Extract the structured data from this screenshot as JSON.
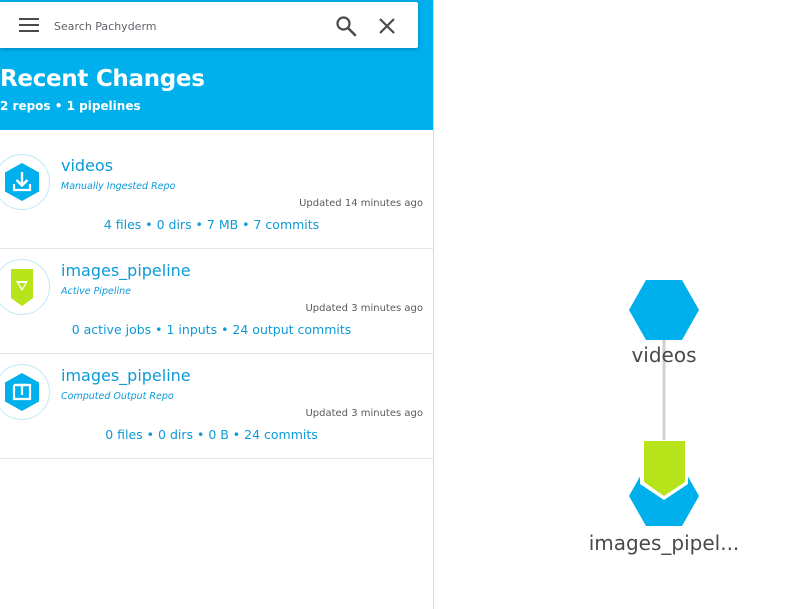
{
  "search": {
    "placeholder": "Search Pachyderm"
  },
  "icons": {
    "menu": "menu-icon",
    "search": "search-icon",
    "close": "close-icon",
    "repo_ingest": "download-hexagon-icon",
    "pipeline": "pipeline-chevron-icon",
    "repo_output": "output-hexagon-icon"
  },
  "header": {
    "title": "Recent Changes",
    "subtitle": "2 repos • 1 pipelines"
  },
  "items": [
    {
      "name": "videos",
      "type": "Manually Ingested Repo",
      "updated": "Updated 14 minutes ago",
      "stats": "4 files • 0 dirs • 7 MB • 7 commits"
    },
    {
      "name": "images_pipeline",
      "type": "Active Pipeline",
      "updated": "Updated 3 minutes ago",
      "stats": "0 active jobs • 1 inputs • 24 output commits"
    },
    {
      "name": "images_pipeline",
      "type": "Computed Output Repo",
      "updated": "Updated 3 minutes ago",
      "stats": "0 files • 0 dirs • 0 B • 24 commits"
    }
  ],
  "dag": {
    "nodes": [
      {
        "label": "videos"
      },
      {
        "label": "images_pipel..."
      }
    ]
  },
  "colors": {
    "brand_blue": "#00b0ec",
    "link_blue": "#0c9ad8",
    "pipeline_green": "#b6e319",
    "edge_gray": "#cfcfcf"
  }
}
